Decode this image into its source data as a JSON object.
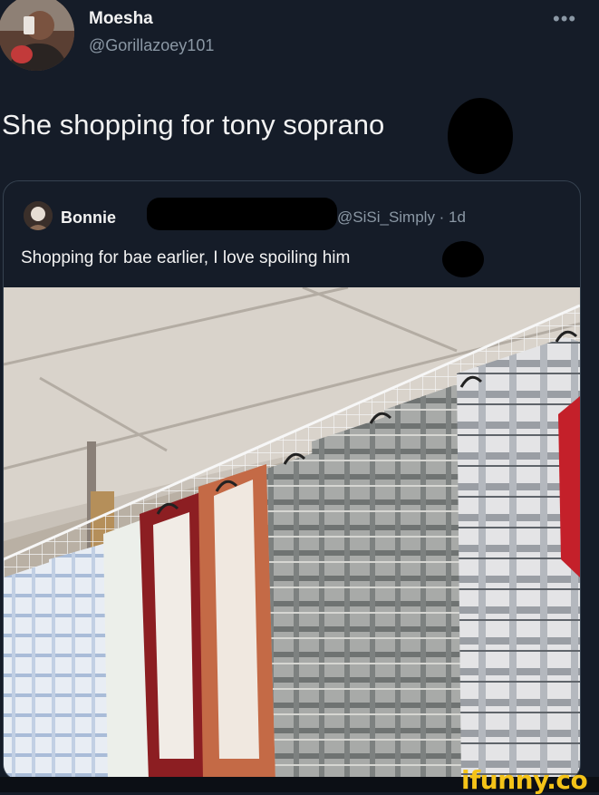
{
  "tweet": {
    "author_name": "Moesha",
    "author_handle": "@Gorillazoey101",
    "more_icon": "•••",
    "text": "She shopping for tony soprano"
  },
  "quoted_tweet": {
    "author_name": "Bonnie",
    "author_handle": "@SiSi_Simply · 1d",
    "text": "Shopping for bae earlier, I love spoiling him"
  },
  "watermark": {
    "text": "ifunny.co"
  },
  "colors": {
    "background": "#151c28",
    "secondary_text": "#8b98a5",
    "watermark": "#f4c318"
  }
}
